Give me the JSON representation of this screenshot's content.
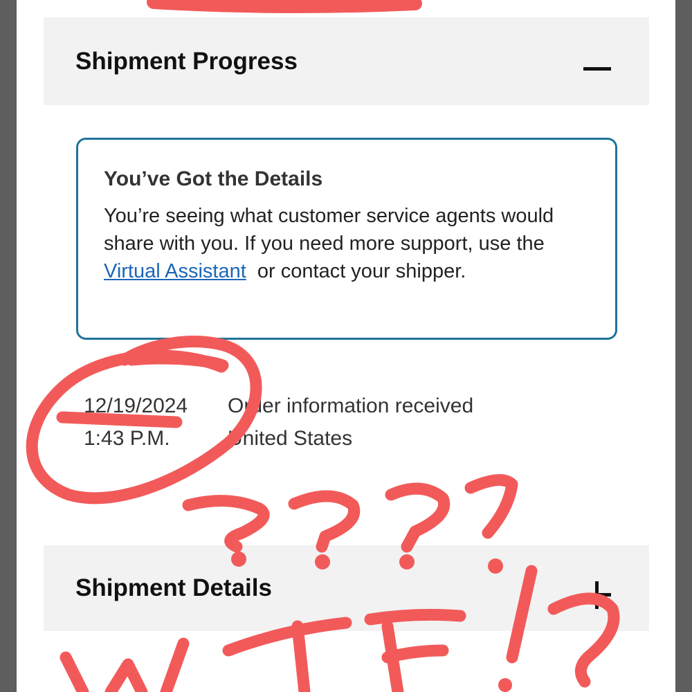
{
  "progress_section": {
    "title": "Shipment Progress",
    "toggle_icon": "minus-icon"
  },
  "notice": {
    "title": "You’ve Got the Details",
    "body_before_link": "You’re seeing what customer service agents would share with you. If you need more support, use the ",
    "link_label": "Virtual Assistant",
    "body_after_link": "  or contact your shipper."
  },
  "events": [
    {
      "date": "12/19/2024",
      "time": "1:43 P.M.",
      "description": "Order information received",
      "location": "United States"
    }
  ],
  "details_section": {
    "title": "Shipment Details",
    "toggle_icon": "plus-icon"
  },
  "colors": {
    "link": "#1a66b8",
    "notice_border": "#1d7399",
    "header_bg": "#f2f2f2",
    "annotation": "#f25a5a"
  },
  "annotation_text": "???? WTF!?"
}
